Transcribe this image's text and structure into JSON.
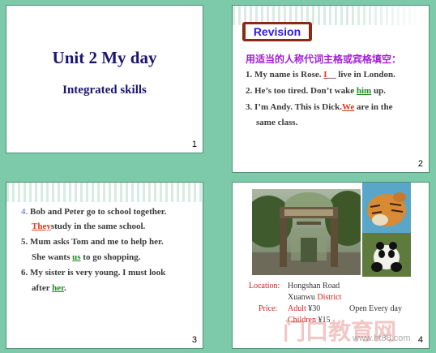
{
  "slide1": {
    "title": "Unit 2  My day",
    "subtitle": "Integrated skills",
    "number": "1"
  },
  "slide2": {
    "button": "Revision",
    "heading": "用适当的人称代词主格或宾格填空：",
    "s1_a": "1. My name is Rose. ",
    "s1_ans": "I",
    "s1_b": "__ live in London.",
    "s2_a": "2. He’s too tired. Don’t wake ",
    "s2_ans": "him",
    "s2_b": " up.",
    "s3_a": "3. I’m Andy. This is Dick.",
    "s3_ans": "We",
    "s3_b": "  are in the",
    "s3_c": "same class.",
    "number": "2"
  },
  "slide3": {
    "l1_num": "4. ",
    "l1": "Bob and Peter go to school together.",
    "l2_ans": "They",
    "l2": "study in  the same school.",
    "l3": "5. Mum asks Tom and me to help her.",
    "l4_a": "She wants ",
    "l4_ans": "us",
    "l4_b": " to go shopping.",
    "l5": "6. My sister is very young. I must look",
    "l6_a": "after ",
    "l6_ans": "her",
    "l6_b": ".",
    "number": "3"
  },
  "slide4": {
    "location_label": "Location:",
    "location_1": "Hongshan Road",
    "location_2a": "Xuanwu ",
    "location_2b": "District",
    "price_label": "Price:",
    "adult_label": "Adult",
    "adult_price": "¥30",
    "children_label": "Children",
    "children_price": "¥15",
    "open": "Open Every day",
    "watermark": "门口教育网",
    "watermark_url": "www.ht88.com",
    "number": "4"
  },
  "colors": {
    "background": "#7ccaa9",
    "title": "#1a1670",
    "heading": "#a21ed6",
    "answer_red": "#e03a10",
    "answer_green": "#1e8a1e"
  }
}
